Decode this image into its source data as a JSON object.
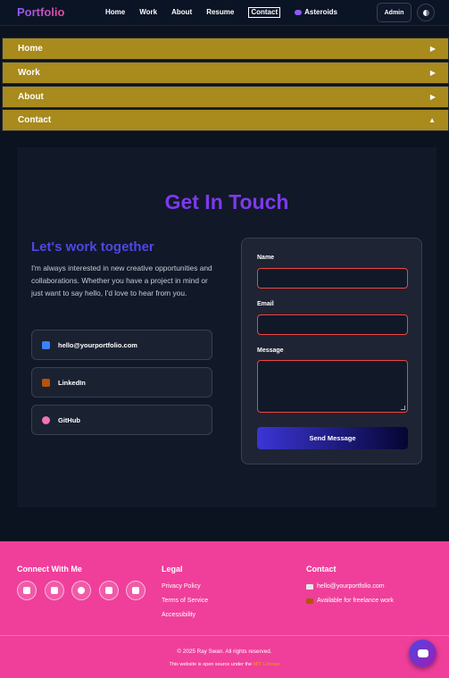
{
  "nav": {
    "brand": "Portfolio",
    "links": [
      "Home",
      "Work",
      "About",
      "Resume",
      "Contact",
      "Asteroids"
    ],
    "active": "Contact",
    "admin_label": "Admin"
  },
  "accordion": [
    {
      "label": "Home",
      "arrow": "▶"
    },
    {
      "label": "Work",
      "arrow": "▶"
    },
    {
      "label": "About",
      "arrow": "▶"
    },
    {
      "label": "Contact",
      "arrow": "▲"
    }
  ],
  "contact": {
    "title": "Get In Touch",
    "subtitle": "Let's work together",
    "intro": "I'm always interested in new creative opportunities and collaborations. Whether you have a project in mind or just want to say hello, I'd love to hear from you.",
    "links": [
      {
        "label": "hello@yourportfolio.com",
        "icon": "email-icon",
        "color": "#3b82f6"
      },
      {
        "label": "LinkedIn",
        "icon": "briefcase-icon",
        "color": "#b45309"
      },
      {
        "label": "GitHub",
        "icon": "octocat-icon",
        "color": "#f472b6"
      }
    ],
    "form": {
      "name_label": "Name",
      "email_label": "Email",
      "message_label": "Message",
      "submit_label": "Send Message"
    }
  },
  "footer": {
    "connect_heading": "Connect With Me",
    "social_icons": [
      "twitter-icon",
      "linkedin-icon",
      "github-icon",
      "instagram-icon",
      "youtube-icon"
    ],
    "legal_heading": "Legal",
    "legal_links": [
      "Privacy Policy",
      "Terms of Service",
      "Accessibility"
    ],
    "contact_heading": "Contact",
    "contact_items": [
      "hello@yourportfolio.com",
      "Available for freelance work"
    ],
    "copyright": "© 2025 Ray Swan. All rights reserved.",
    "license_text": "This website is open source under the",
    "license_link": "MIT License"
  },
  "colors": {
    "accordion": "#a88a1d",
    "footer": "#ef3f9a",
    "title": "#7c3aed",
    "input_border": "#ef4444"
  }
}
